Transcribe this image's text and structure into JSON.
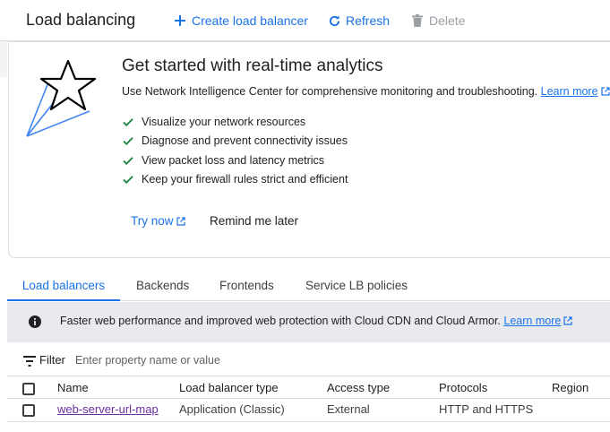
{
  "header": {
    "title": "Load balancing",
    "create_label": "Create load balancer",
    "refresh_label": "Refresh",
    "delete_label": "Delete"
  },
  "analytics_card": {
    "title": "Get started with real-time analytics",
    "description": "Use Network Intelligence Center for comprehensive monitoring and troubleshooting.",
    "learn_more": "Learn more",
    "features": [
      "Visualize your network resources",
      "Diagnose and prevent connectivity issues",
      "View packet loss and latency metrics",
      "Keep your firewall rules strict and efficient"
    ],
    "try_now": "Try now",
    "remind_later": "Remind me later"
  },
  "tabs": [
    {
      "label": "Load balancers",
      "active": true
    },
    {
      "label": "Backends",
      "active": false
    },
    {
      "label": "Frontends",
      "active": false
    },
    {
      "label": "Service LB policies",
      "active": false
    }
  ],
  "banner": {
    "text": "Faster web performance and improved web protection with Cloud CDN and Cloud Armor.",
    "link": "Learn more"
  },
  "filter": {
    "label": "Filter",
    "placeholder": "Enter property name or value"
  },
  "table": {
    "columns": [
      "Name",
      "Load balancer type",
      "Access type",
      "Protocols",
      "Region"
    ],
    "rows": [
      {
        "name": "web-server-url-map",
        "type": "Application (Classic)",
        "access": "External",
        "protocols": "HTTP and HTTPS",
        "region": ""
      }
    ]
  },
  "colors": {
    "accent": "#1a73e8",
    "check": "#188038",
    "banner_bg": "#e8eaed",
    "visited_link": "#6b2fa0"
  }
}
